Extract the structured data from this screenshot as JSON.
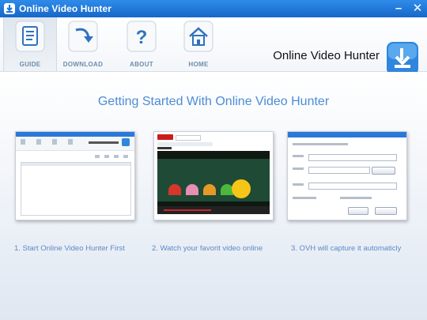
{
  "window": {
    "title": "Online Video Hunter",
    "minimize": "–",
    "close": "✕"
  },
  "toolbar": {
    "items": [
      {
        "label": "GUIDE",
        "icon": "document-icon",
        "active": true
      },
      {
        "label": "DOWNLOAD",
        "icon": "download-arrow-icon",
        "active": false
      },
      {
        "label": "ABOUT",
        "icon": "question-icon",
        "active": false
      },
      {
        "label": "HOME",
        "icon": "home-icon",
        "active": false
      }
    ],
    "brand": "Online Video Hunter"
  },
  "main": {
    "heading": "Getting Started With Online Video Hunter",
    "steps": [
      {
        "caption": "1. Start Online Video Hunter First"
      },
      {
        "caption": "2. Watch your favorit video online"
      },
      {
        "caption": "3. OVH will capture it automaticly"
      }
    ]
  },
  "colors": {
    "titlebar": "#1f74d8",
    "accent": "#4c8cd6",
    "caption": "#5a8ac6",
    "label": "#6c8cac"
  }
}
